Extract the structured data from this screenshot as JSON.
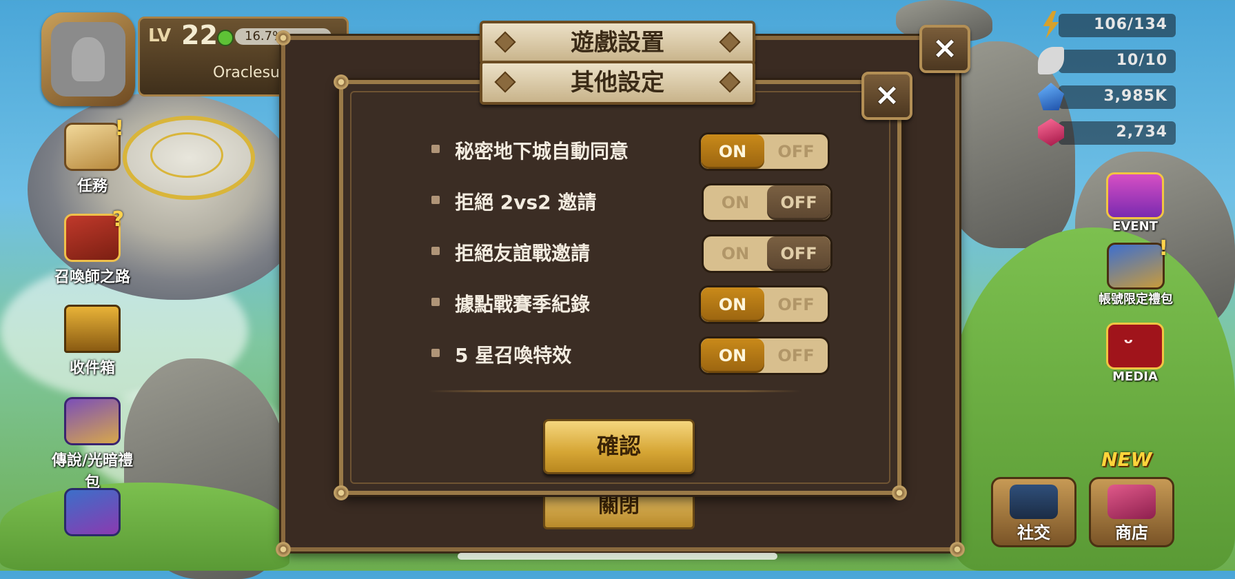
{
  "player": {
    "lv_label": "LV",
    "level": "22",
    "exp_percent": "16.7%",
    "name": "Oraclesummon"
  },
  "left_menu": [
    {
      "label": "任務",
      "icon": "quest-scroll-icon"
    },
    {
      "label": "召喚師之路",
      "icon": "summoner-path-book-icon"
    },
    {
      "label": "收件箱",
      "icon": "inbox-chest-icon"
    },
    {
      "label": "傳說/光暗禮包",
      "icon": "legend-pack-icon"
    }
  ],
  "resources": [
    {
      "value": "106/134",
      "icon": "energy-icon"
    },
    {
      "value": "10/10",
      "icon": "wing-icon"
    },
    {
      "value": "3,985K",
      "icon": "crystal-icon"
    },
    {
      "value": "2,734",
      "icon": "ruby-icon"
    }
  ],
  "right_menu": [
    {
      "label": "EVENT",
      "icon": "event-gift-icon"
    },
    {
      "label": "帳號限定禮包",
      "icon": "account-limited-pack-icon"
    },
    {
      "label": "MEDIA",
      "icon": "media-tv-icon"
    }
  ],
  "bottom_buttons": [
    {
      "label": "社交",
      "icon": "social-wizard-hat-icon"
    },
    {
      "label": "商店",
      "icon": "shop-crystal-icon"
    }
  ],
  "new_badge": "NEW",
  "back_dialog": {
    "title": "遊戲設置",
    "close_label": "×",
    "close_button_label": "關閉"
  },
  "front_dialog": {
    "title": "其他設定",
    "close_label": "×",
    "on_label": "ON",
    "off_label": "OFF",
    "settings": [
      {
        "label": "秘密地下城自動同意",
        "state": "on"
      },
      {
        "label": "拒絕 2vs2 邀請",
        "state": "off"
      },
      {
        "label": "拒絕友誼戰邀請",
        "state": "off"
      },
      {
        "label": "據點戰賽季紀錄",
        "state": "on"
      },
      {
        "label": "5 星召喚特效",
        "state": "on"
      }
    ],
    "confirm_label": "確認"
  },
  "colors": {
    "toggle_on": "#c98a1a",
    "toggle_off": "#7a6042",
    "dialog_bg": "#3b2d24",
    "dialog_border": "#9a7a48"
  }
}
